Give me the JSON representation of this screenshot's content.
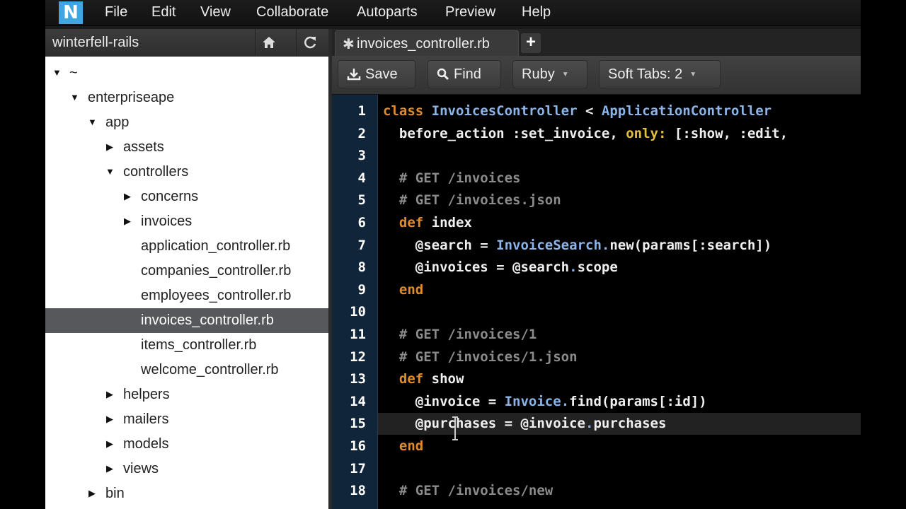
{
  "app": {
    "logo_letter": "N"
  },
  "menubar": {
    "items": [
      "File",
      "Edit",
      "View",
      "Collaborate",
      "Autoparts",
      "Preview",
      "Help"
    ]
  },
  "sidebar": {
    "project": "winterfell-rails",
    "tree": [
      {
        "label": "~",
        "expanded": true
      },
      {
        "label": "enterpriseape",
        "expanded": true
      },
      {
        "label": "app",
        "expanded": true
      },
      {
        "label": "assets",
        "expanded": false
      },
      {
        "label": "controllers",
        "expanded": true
      },
      {
        "label": "concerns",
        "expanded": false
      },
      {
        "label": "invoices",
        "expanded": false
      },
      {
        "label": "application_controller.rb"
      },
      {
        "label": "companies_controller.rb"
      },
      {
        "label": "employees_controller.rb"
      },
      {
        "label": "invoices_controller.rb",
        "selected": true
      },
      {
        "label": "items_controller.rb"
      },
      {
        "label": "welcome_controller.rb"
      },
      {
        "label": "helpers",
        "expanded": false
      },
      {
        "label": "mailers",
        "expanded": false
      },
      {
        "label": "models",
        "expanded": false
      },
      {
        "label": "views",
        "expanded": false
      },
      {
        "label": "bin",
        "expanded": false
      }
    ]
  },
  "tabs": {
    "active": "invoices_controller.rb",
    "modified_marker": "✱",
    "add": "+"
  },
  "toolbar": {
    "save": "Save",
    "find": "Find",
    "language": "Ruby",
    "indent": "Soft Tabs: 2"
  },
  "editor": {
    "current_line": 15,
    "lines": [
      "class InvoicesController < ApplicationController",
      "  before_action :set_invoice, only: [:show, :edit,",
      "",
      "  # GET /invoices",
      "  # GET /invoices.json",
      "  def index",
      "    @search = InvoiceSearch.new(params[:search])",
      "    @invoices = @search.scope",
      "  end",
      "",
      "  # GET /invoices/1",
      "  # GET /invoices/1.json",
      "  def show",
      "    @invoice = Invoice.find(params[:id])",
      "    @purchases = @invoice.purchases",
      "  end",
      "",
      "  # GET /invoices/new"
    ]
  }
}
